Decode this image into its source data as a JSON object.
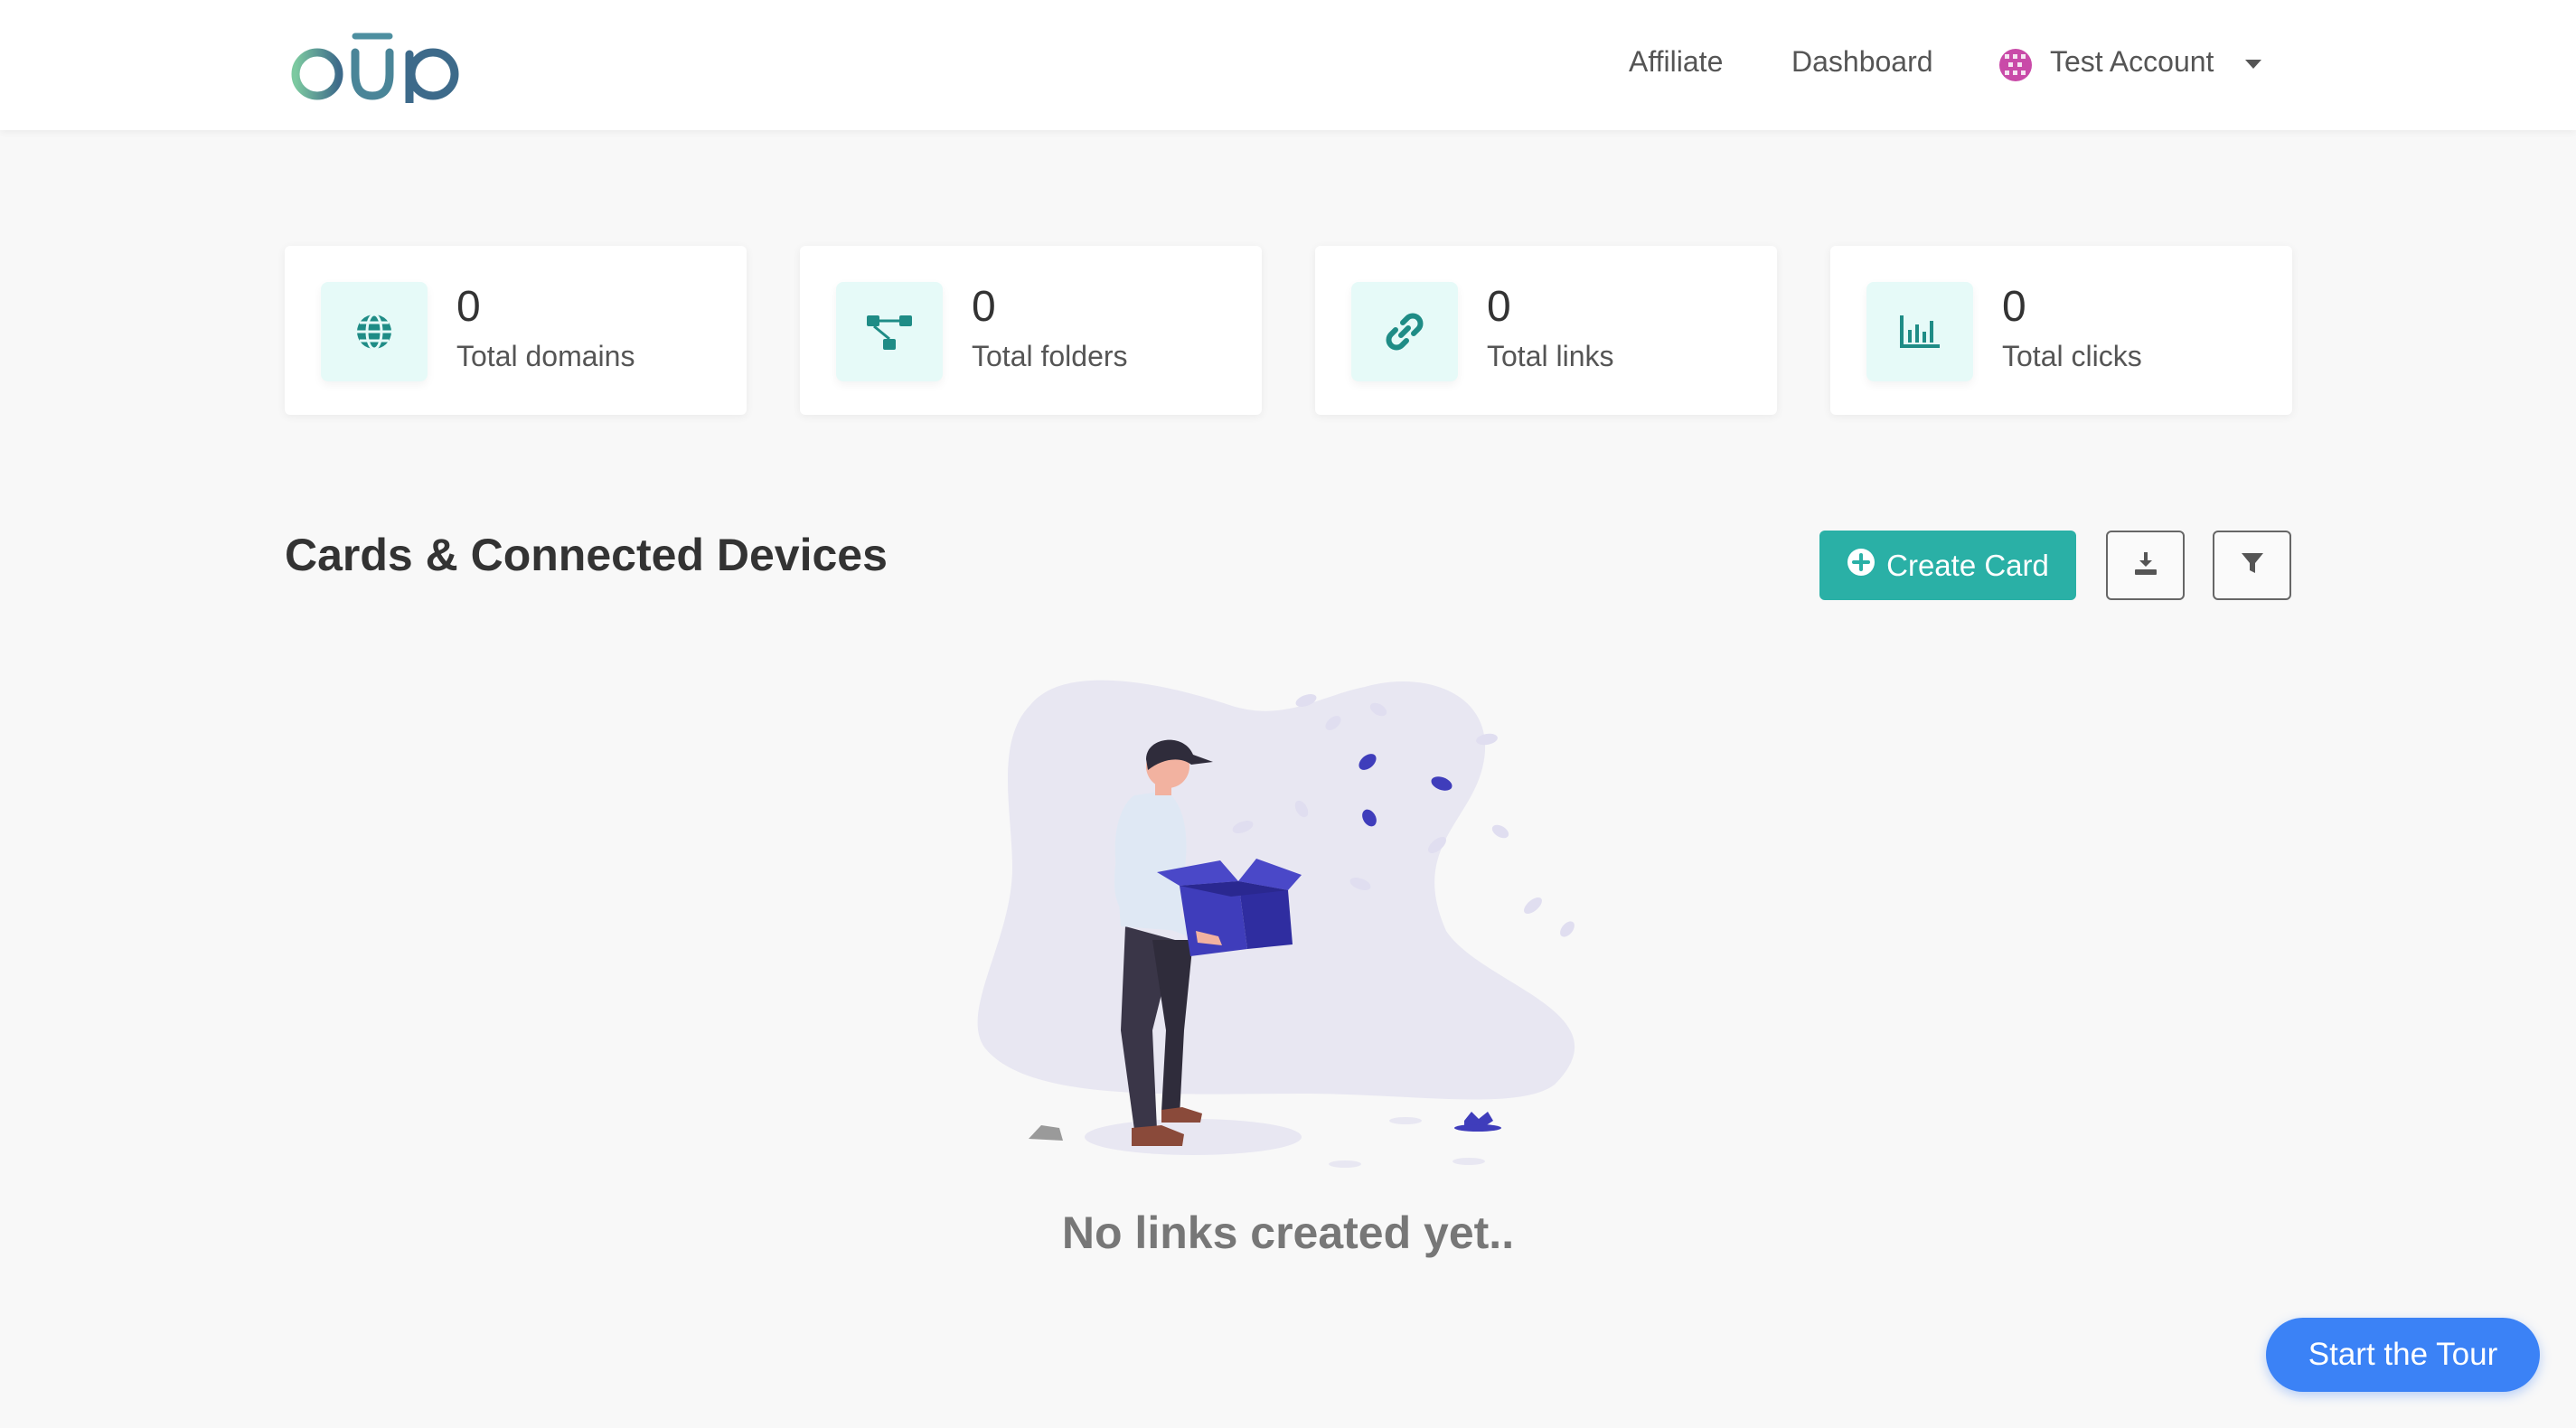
{
  "nav": {
    "logo_text": "būp",
    "links": [
      "Affiliate",
      "Dashboard"
    ],
    "account_label": "Test Account"
  },
  "stats": [
    {
      "value": "0",
      "label": "Total domains",
      "icon": "globe-icon"
    },
    {
      "value": "0",
      "label": "Total folders",
      "icon": "folder-tree-icon"
    },
    {
      "value": "0",
      "label": "Total links",
      "icon": "link-icon"
    },
    {
      "value": "0",
      "label": "Total clicks",
      "icon": "bar-chart-icon"
    }
  ],
  "section": {
    "title": "Cards & Connected Devices",
    "create_button": "Create Card",
    "download_icon": "download-icon",
    "filter_icon": "filter-icon"
  },
  "empty_state": {
    "message": "No links created yet.."
  },
  "tour_button": "Start the Tour",
  "colors": {
    "accent": "#2ab0a6",
    "icon_bg": "#e6faf8",
    "tour": "#3b82f6",
    "illustration_blue": "#3f3dbb"
  }
}
